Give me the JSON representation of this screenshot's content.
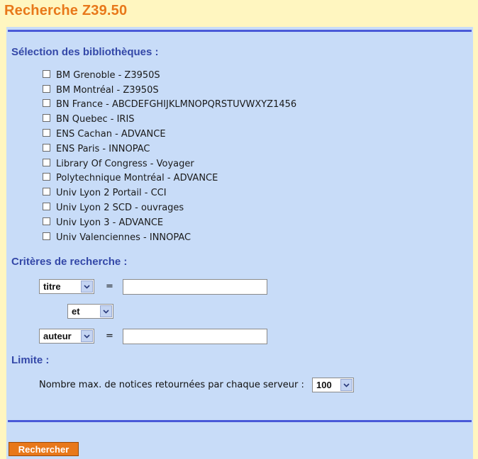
{
  "page": {
    "title": "Recherche Z39.50"
  },
  "libraries": {
    "heading": "Sélection des bibliothèques :",
    "items": [
      {
        "label": "BM Grenoble - Z3950S",
        "checked": false
      },
      {
        "label": "BM Montréal - Z3950S",
        "checked": false
      },
      {
        "label": "BN France - ABCDEFGHIJKLMNOPQRSTUVWXYZ1456",
        "checked": false
      },
      {
        "label": "BN Quebec - IRIS",
        "checked": false
      },
      {
        "label": "ENS Cachan - ADVANCE",
        "checked": false
      },
      {
        "label": "ENS Paris - INNOPAC",
        "checked": false
      },
      {
        "label": "Library Of Congress - Voyager",
        "checked": false
      },
      {
        "label": "Polytechnique Montréal - ADVANCE",
        "checked": false
      },
      {
        "label": "Univ Lyon 2 Portail - CCI",
        "checked": false
      },
      {
        "label": "Univ Lyon 2 SCD - ouvrages",
        "checked": false
      },
      {
        "label": "Univ Lyon 3 - ADVANCE",
        "checked": false
      },
      {
        "label": "Univ Valenciennes - INNOPAC",
        "checked": false
      }
    ]
  },
  "criteria": {
    "heading": "Critères de recherche :",
    "field1": {
      "selected": "titre",
      "equals": "=",
      "value": ""
    },
    "operator": {
      "selected": "et"
    },
    "field2": {
      "selected": "auteur",
      "equals": "=",
      "value": ""
    }
  },
  "limit": {
    "heading": "Limite :",
    "label": "Nombre max. de notices retournées par chaque serveur :",
    "selected": "100"
  },
  "actions": {
    "submit_label": "Rechercher"
  },
  "colors": {
    "accent": "#e8781a",
    "panel": "#c8dcf8",
    "heading": "#3448a8",
    "rule": "#4a5ad8",
    "background": "#fff6c0"
  }
}
